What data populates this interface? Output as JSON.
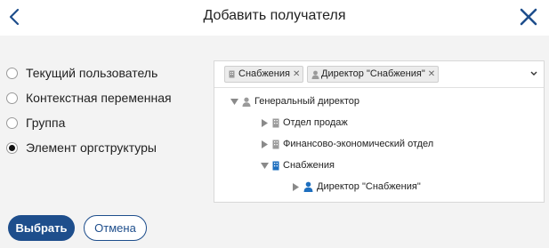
{
  "header": {
    "title": "Добавить получателя"
  },
  "recipient_types": [
    {
      "label": "Текущий пользователь",
      "selected": false
    },
    {
      "label": "Контекстная переменная",
      "selected": false
    },
    {
      "label": "Группа",
      "selected": false
    },
    {
      "label": "Элемент оргструктуры",
      "selected": true
    }
  ],
  "selected_tags": [
    {
      "label": "Снабжения",
      "icon": "department-icon"
    },
    {
      "label": "Директор \"Снабжения\"",
      "icon": "user-icon"
    }
  ],
  "tree": [
    {
      "label": "Генеральный директор",
      "icon": "user-icon",
      "state": "expanded",
      "level": 0
    },
    {
      "label": "Отдел продаж",
      "icon": "department-icon",
      "state": "collapsed",
      "level": 1
    },
    {
      "label": "Финансово-экономический отдел",
      "icon": "department-icon",
      "state": "collapsed",
      "level": 1
    },
    {
      "label": "Снабжения",
      "icon": "department-icon",
      "state": "expanded",
      "level": 1,
      "selected": true
    },
    {
      "label": "Директор \"Снабжения\"",
      "icon": "user-icon",
      "state": "collapsed",
      "level": 2,
      "selected": true
    }
  ],
  "buttons": {
    "select_label": "Выбрать",
    "cancel_label": "Отмена"
  },
  "colors": {
    "accent": "#1e4e8c",
    "selected_icon": "#1e6fbf",
    "inactive_icon": "#9a9a9a"
  }
}
